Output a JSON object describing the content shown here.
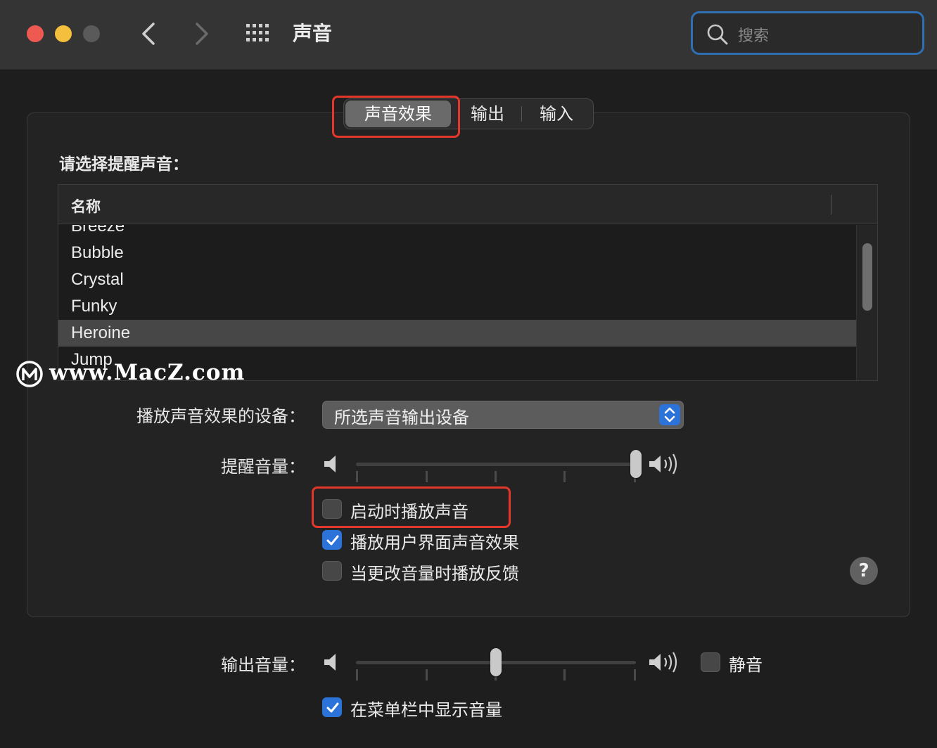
{
  "window": {
    "title": "声音",
    "search_placeholder": "搜索"
  },
  "tabs": {
    "sound_effects": "声音效果",
    "output": "输出",
    "input": "输入"
  },
  "alert": {
    "choose_label": "请选择提醒声音：",
    "column_name": "名称",
    "sounds": [
      "Breeze",
      "Bubble",
      "Crystal",
      "Funky",
      "Heroine",
      "Jump"
    ],
    "selected": "Heroine"
  },
  "device": {
    "label": "播放声音效果的设备：",
    "value": "所选声音输出设备"
  },
  "alert_volume": {
    "label": "提醒音量：",
    "level": 1.0
  },
  "checkboxes": {
    "startup": {
      "label": "启动时播放声音",
      "checked": false
    },
    "ui_effects": {
      "label": "播放用户界面声音效果",
      "checked": true
    },
    "feedback": {
      "label": "当更改音量时播放反馈",
      "checked": false
    }
  },
  "help_label": "?",
  "output_volume": {
    "label": "输出音量：",
    "level": 0.5,
    "mute_label": "静音",
    "mute_checked": false
  },
  "menubar": {
    "label": "在菜单栏中显示音量",
    "checked": true
  },
  "watermark": {
    "text": "www.MacZ.com"
  },
  "colors": {
    "accent": "#2c73d9",
    "highlight_box": "#e2372a",
    "search_border": "#2f6fb4"
  }
}
